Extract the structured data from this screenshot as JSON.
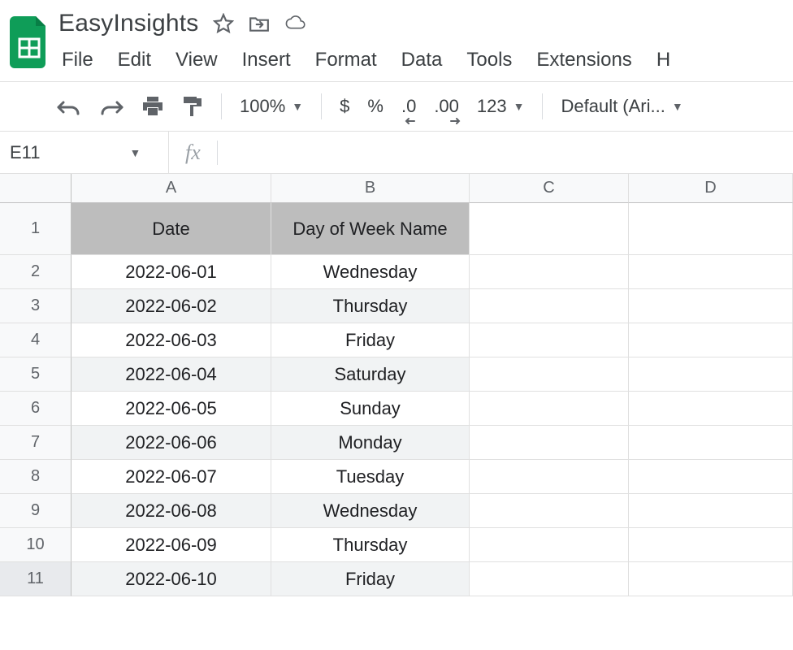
{
  "header": {
    "title": "EasyInsights",
    "icons": [
      "star-icon",
      "move-to-folder-icon",
      "cloud-status-icon"
    ]
  },
  "menu": {
    "items": [
      "File",
      "Edit",
      "View",
      "Insert",
      "Format",
      "Data",
      "Tools",
      "Extensions",
      "H"
    ]
  },
  "toolbar": {
    "zoom": "100%",
    "currency": "$",
    "percent": "%",
    "dec_decrease": ".0",
    "dec_increase": ".00",
    "format_more": "123",
    "font": "Default (Ari..."
  },
  "namebox": {
    "value": "E11"
  },
  "formula": {
    "fx": "fx",
    "value": ""
  },
  "grid": {
    "col_labels": [
      "A",
      "B",
      "C",
      "D"
    ],
    "row_labels": [
      "1",
      "2",
      "3",
      "4",
      "5",
      "6",
      "7",
      "8",
      "9",
      "10",
      "11"
    ],
    "header_row": [
      "Date",
      "Day of Week Name"
    ],
    "rows": [
      {
        "a": "2022-06-01",
        "b": "Wednesday"
      },
      {
        "a": "2022-06-02",
        "b": "Thursday"
      },
      {
        "a": "2022-06-03",
        "b": "Friday"
      },
      {
        "a": "2022-06-04",
        "b": "Saturday"
      },
      {
        "a": "2022-06-05",
        "b": "Sunday"
      },
      {
        "a": "2022-06-06",
        "b": "Monday"
      },
      {
        "a": "2022-06-07",
        "b": "Tuesday"
      },
      {
        "a": "2022-06-08",
        "b": "Wednesday"
      },
      {
        "a": "2022-06-09",
        "b": "Thursday"
      },
      {
        "a": "2022-06-10",
        "b": "Friday"
      }
    ]
  }
}
